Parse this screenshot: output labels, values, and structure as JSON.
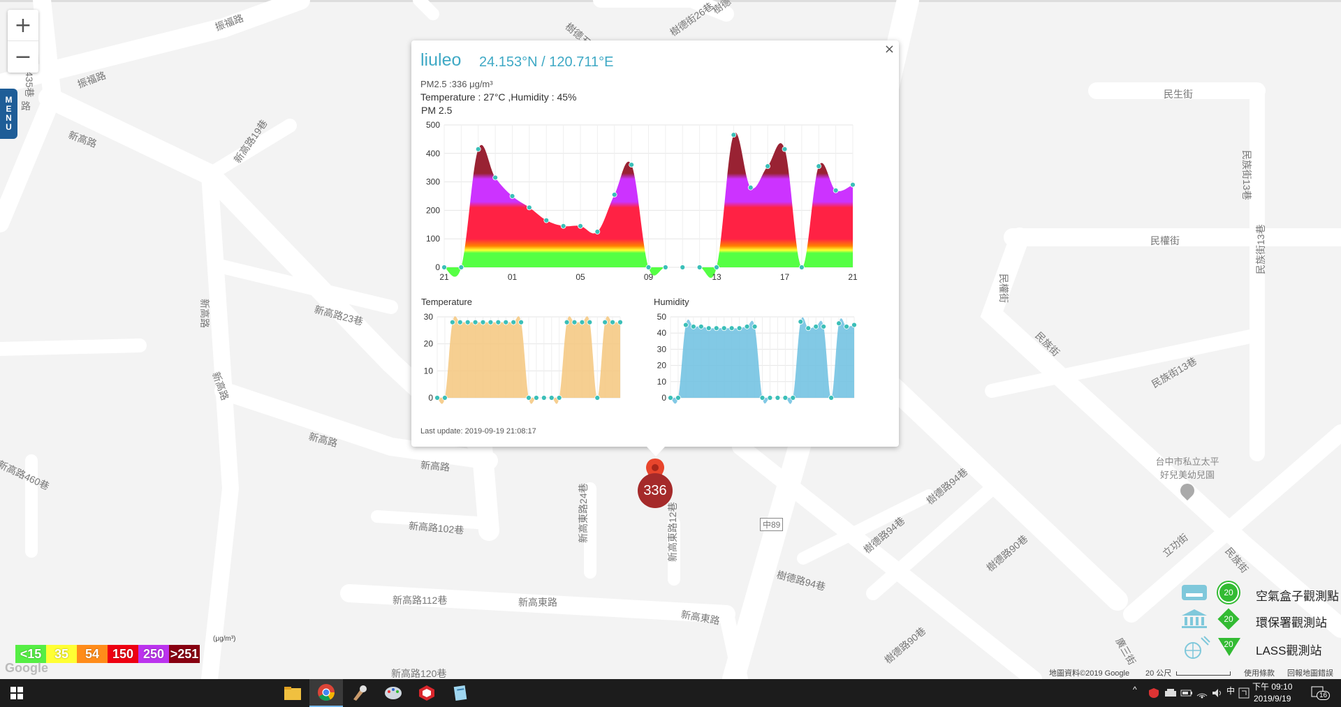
{
  "map": {
    "zoom_in": "+",
    "zoom_out": "−",
    "menu_label": [
      "M",
      "E",
      "N",
      "U"
    ],
    "roads": [
      {
        "text": "振福路435巷",
        "x": 52,
        "y": 60,
        "rot": 90
      },
      {
        "text": "振福路",
        "x": 305,
        "y": 30,
        "rot": -20
      },
      {
        "text": "振福路",
        "x": 108,
        "y": 112,
        "rot": -20
      },
      {
        "text": "路",
        "x": 30,
        "y": 142,
        "rot": 0
      },
      {
        "text": "新高路",
        "x": 102,
        "y": 183,
        "rot": 20
      },
      {
        "text": "新高路19巷",
        "x": 330,
        "y": 226,
        "rot": -55
      },
      {
        "text": "樹德五街",
        "x": 818,
        "y": 28,
        "rot": 40
      },
      {
        "text": "樹德街26巷",
        "x": 955,
        "y": 40,
        "rot": -35
      },
      {
        "text": "樹德",
        "x": 1016,
        "y": 8,
        "rot": -35
      },
      {
        "text": "民生街",
        "x": 1666,
        "y": 125,
        "rot": 0
      },
      {
        "text": "民族街13巷",
        "x": 1795,
        "y": 215,
        "rot": 90
      },
      {
        "text": "民權街",
        "x": 1647,
        "y": 335,
        "rot": 0
      },
      {
        "text": "民權街",
        "x": 1447,
        "y": 392,
        "rot": 90
      },
      {
        "text": "民族街13巷",
        "x": 1795,
        "y": 393,
        "rot": -90
      },
      {
        "text": "民族街",
        "x": 1492,
        "y": 471,
        "rot": 45
      },
      {
        "text": "民族街13巷",
        "x": 1645,
        "y": 543,
        "rot": -30
      },
      {
        "text": "新高路23巷",
        "x": 453,
        "y": 433,
        "rot": 15
      },
      {
        "text": "新高路",
        "x": 303,
        "y": 428,
        "rot": 90
      },
      {
        "text": "新高路",
        "x": 318,
        "y": 530,
        "rot": 70
      },
      {
        "text": "新高路",
        "x": 445,
        "y": 615,
        "rot": 15
      },
      {
        "text": "新高路",
        "x": 603,
        "y": 656,
        "rot": 5
      },
      {
        "text": "新高路460巷",
        "x": 2,
        "y": 655,
        "rot": 25
      },
      {
        "text": "新高路102巷",
        "x": 586,
        "y": 743,
        "rot": 5
      },
      {
        "text": "新高東路24巷",
        "x": 825,
        "y": 778,
        "rot": -90
      },
      {
        "text": "新高東路12巷",
        "x": 953,
        "y": 805,
        "rot": -90
      },
      {
        "text": "中89",
        "x": 1088,
        "y": 742,
        "rot": 0
      },
      {
        "text": "樹德路94巷",
        "x": 1322,
        "y": 712,
        "rot": -40
      },
      {
        "text": "樹德路94巷",
        "x": 1232,
        "y": 782,
        "rot": -40
      },
      {
        "text": "樹德路94巷",
        "x": 1115,
        "y": 813,
        "rot": 15
      },
      {
        "text": "樹德路90巷",
        "x": 1408,
        "y": 808,
        "rot": -40
      },
      {
        "text": "新高路112巷",
        "x": 562,
        "y": 850,
        "rot": 0
      },
      {
        "text": "新高東路",
        "x": 742,
        "y": 853,
        "rot": 0
      },
      {
        "text": "新高東路",
        "x": 977,
        "y": 870,
        "rot": 10
      },
      {
        "text": "新高路120巷",
        "x": 560,
        "y": 955,
        "rot": 0
      },
      {
        "text": "樹德路90巷",
        "x": 1262,
        "y": 940,
        "rot": -40
      },
      {
        "text": "立功街",
        "x": 1660,
        "y": 787,
        "rot": -40
      },
      {
        "text": "民族街",
        "x": 1765,
        "y": 780,
        "rot": 50
      },
      {
        "text": "廣三街",
        "x": 1610,
        "y": 910,
        "rot": 60
      }
    ],
    "poi": {
      "line1": "台中市私立太平",
      "line2": "好兒美幼兒園"
    }
  },
  "popup": {
    "close": "×",
    "title": "liuleo",
    "coords": "24.153°N / 120.711°E",
    "pm_line": "PM2.5 :336 μg/m³",
    "th_line": "Temperature : 27°C ,Humidity : 45%",
    "chart_label": "PM 2.5",
    "temp_label": "Temperature",
    "hum_label": "Humidity",
    "last_update": "Last update: 2019-09-19 21:08:17"
  },
  "marker": {
    "value": "336",
    "color": "#a52a2a"
  },
  "chart_data": [
    {
      "type": "area",
      "title": "PM 2.5",
      "xticks": [
        "21",
        "01",
        "05",
        "09",
        "13",
        "17",
        "21"
      ],
      "yticks": [
        0,
        100,
        200,
        300,
        400,
        500
      ],
      "ylim": [
        0,
        500
      ],
      "x": [
        0,
        1,
        2,
        3,
        4,
        5,
        6,
        7,
        8,
        9,
        10,
        11,
        12,
        13,
        14,
        15,
        16,
        17,
        18,
        19,
        20,
        21,
        22,
        23,
        24
      ],
      "values": [
        0,
        0,
        415,
        315,
        250,
        210,
        165,
        145,
        145,
        125,
        255,
        360,
        0,
        0,
        0,
        0,
        0,
        465,
        280,
        355,
        415,
        0,
        355,
        270,
        290
      ],
      "band_colors": [
        "#55ff44",
        "#ffff33",
        "#ff8000",
        "#ff2244",
        "#cc33ff",
        "#992233"
      ]
    },
    {
      "type": "area",
      "title": "Temperature",
      "yticks": [
        0,
        10,
        20,
        30
      ],
      "ylim": [
        0,
        30
      ],
      "values": [
        0,
        0,
        28,
        28,
        28,
        28,
        28,
        28,
        28,
        28,
        28,
        28,
        0,
        0,
        0,
        0,
        0,
        28,
        28,
        28,
        28,
        0,
        28,
        28,
        28
      ],
      "color": "#f5c77e"
    },
    {
      "type": "area",
      "title": "Humidity",
      "yticks": [
        0,
        10,
        20,
        30,
        40,
        50
      ],
      "ylim": [
        0,
        50
      ],
      "values": [
        0,
        0,
        45,
        44,
        44,
        43,
        43,
        43,
        43,
        43,
        44,
        44,
        0,
        0,
        0,
        0,
        0,
        47,
        43,
        44,
        44,
        0,
        46,
        44,
        45
      ],
      "color": "#6cbfe0"
    }
  ],
  "aqi_legend": {
    "unit": "(μg/m³)",
    "items": [
      {
        "label": "<15",
        "color": "#55ee44"
      },
      {
        "label": "35",
        "color": "#ffff33"
      },
      {
        "label": "54",
        "color": "#ff8c1a"
      },
      {
        "label": "150",
        "color": "#ee0011"
      },
      {
        "label": "250",
        "color": "#bb33ee"
      },
      {
        "label": ">251",
        "color": "#880011"
      }
    ]
  },
  "google_logo": "Google",
  "station_legend": [
    {
      "label": "空氣盒子觀測點",
      "badge": "20",
      "shape": "circle",
      "color": "#33bb33"
    },
    {
      "label": "環保署觀測站",
      "badge": "20",
      "shape": "diamond",
      "color": "#33bb33"
    },
    {
      "label": "LASS觀測站",
      "badge": "20",
      "shape": "triangle",
      "color": "#33bb33"
    }
  ],
  "footer": {
    "copyright": "地圖資料©2019 Google",
    "scale": "20 公尺",
    "terms": "使用條款",
    "report": "回報地圖錯誤"
  },
  "taskbar": {
    "ime": "中",
    "time": "下午 09:10",
    "date": "2019/9/19",
    "notif": "16"
  }
}
